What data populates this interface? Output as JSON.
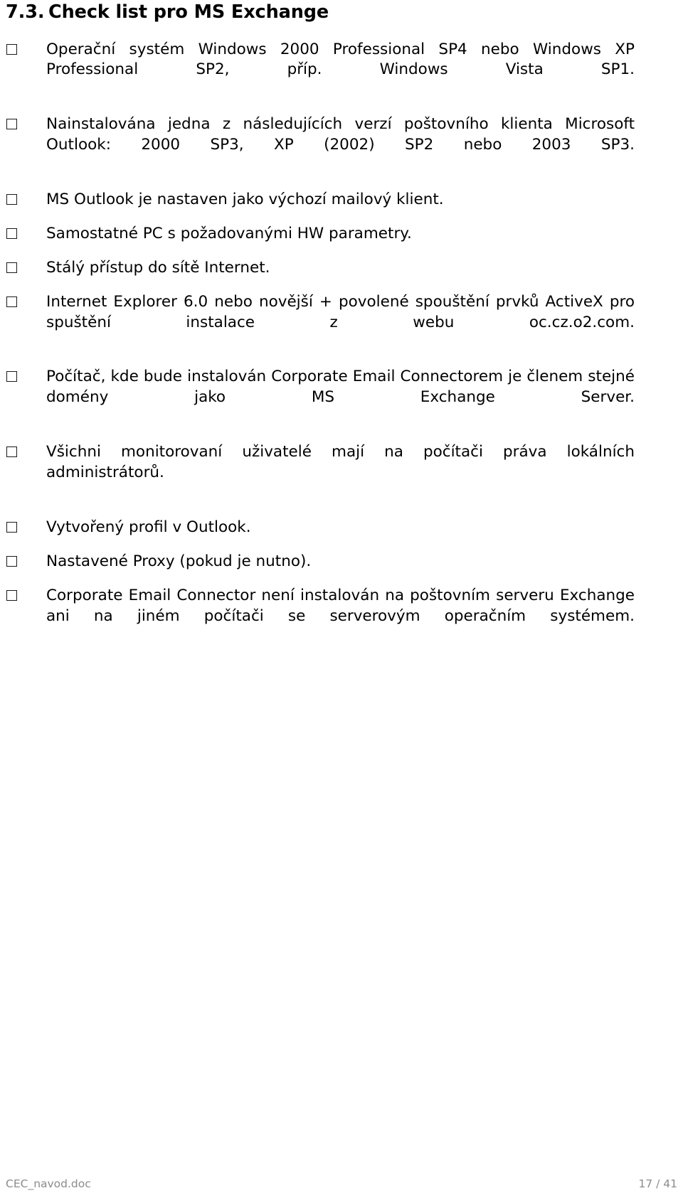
{
  "document": {
    "heading": {
      "number": "7.3.",
      "title": "Check list pro MS Exchange"
    },
    "checklist": [
      {
        "icon": "empty-checkbox",
        "text": "Operační systém Windows 2000 Professional SP4 nebo Windows XP Professional SP2, příp. Windows Vista SP1.",
        "justified": true
      },
      {
        "icon": "empty-checkbox",
        "text": "Nainstalována jedna z následujících verzí poštovního klienta Microsoft Outlook: 2000 SP3, XP (2002) SP2 nebo 2003 SP3.",
        "justified": true
      },
      {
        "icon": "empty-checkbox",
        "text": "MS Outlook je nastaven jako výchozí mailový klient.",
        "justified": false
      },
      {
        "icon": "empty-checkbox",
        "text": "Samostatné PC s požadovanými HW parametry.",
        "justified": false
      },
      {
        "icon": "empty-checkbox",
        "text": "Stálý přístup do sítě Internet.",
        "justified": false
      },
      {
        "icon": "empty-checkbox",
        "text": "Internet Explorer 6.0 nebo novější + povolené spouštění prvků ActiveX pro spuštění instalace z webu oc.cz.o2.com.",
        "justified": true
      },
      {
        "icon": "empty-checkbox",
        "text": "Počítač, kde bude instalován Corporate Email Connectorem je členem stejné domény jako MS Exchange Server.",
        "justified": true
      },
      {
        "icon": "empty-checkbox",
        "text": "Všichni monitorovaní uživatelé mají na počítači práva lokálních administrátorů.",
        "justified": true
      },
      {
        "icon": "empty-checkbox",
        "text": "Vytvořený profil v Outlook.",
        "justified": false
      },
      {
        "icon": "empty-checkbox",
        "text": "Nastavené Proxy (pokud je nutno).",
        "justified": false
      },
      {
        "icon": "empty-checkbox",
        "text": "Corporate Email Connector není instalován na poštovním serveru Exchange ani na jiném počítači se serverovým operačním systémem.",
        "justified": true
      }
    ],
    "footer": {
      "file_name": "CEC_navod.doc",
      "page_indicator": "17 / 41"
    }
  }
}
